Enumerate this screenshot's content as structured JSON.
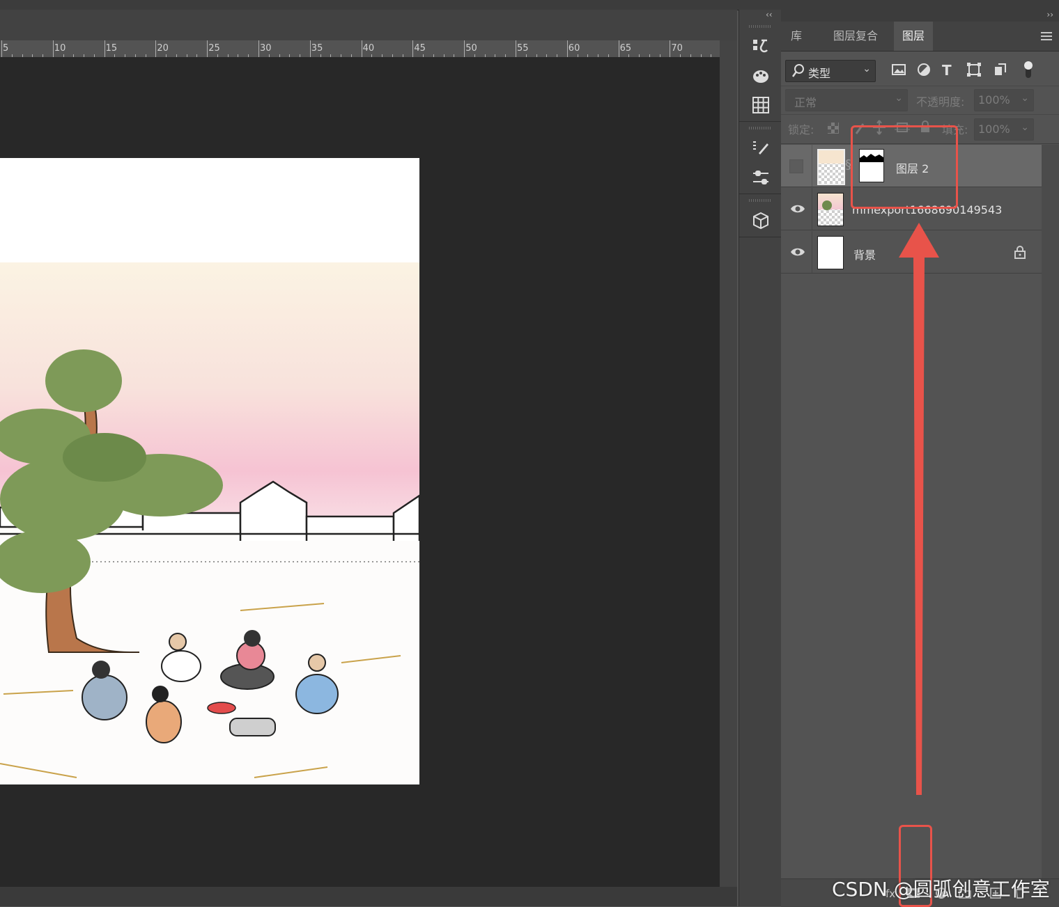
{
  "ruler": {
    "labels": [
      "5",
      "10",
      "15",
      "20",
      "25",
      "30",
      "35",
      "40",
      "45",
      "50",
      "55",
      "60",
      "65",
      "70"
    ]
  },
  "panel_tabs": [
    {
      "label": "库",
      "active": false
    },
    {
      "label": "图层复合",
      "active": false
    },
    {
      "label": "图层",
      "active": true
    }
  ],
  "filter": {
    "kind_label": "类型"
  },
  "blend": {
    "mode": "正常",
    "opacity_label": "不透明度:",
    "opacity_value": "100%"
  },
  "lock": {
    "label": "锁定:",
    "fill_label": "填充:",
    "fill_value": "100%"
  },
  "layers": [
    {
      "name": "图层 2",
      "visible": false,
      "selected": true,
      "has_mask": true
    },
    {
      "name": "mmexport1668690149543",
      "visible": true,
      "selected": false,
      "has_mask": false
    },
    {
      "name": "背景",
      "visible": true,
      "selected": false,
      "locked": true
    }
  ],
  "watermark": "CSDN @圆弧创意工作室",
  "colors": {
    "annotation": "#e8534a",
    "panel_bg": "#535353",
    "pasteboard": "#282828"
  }
}
